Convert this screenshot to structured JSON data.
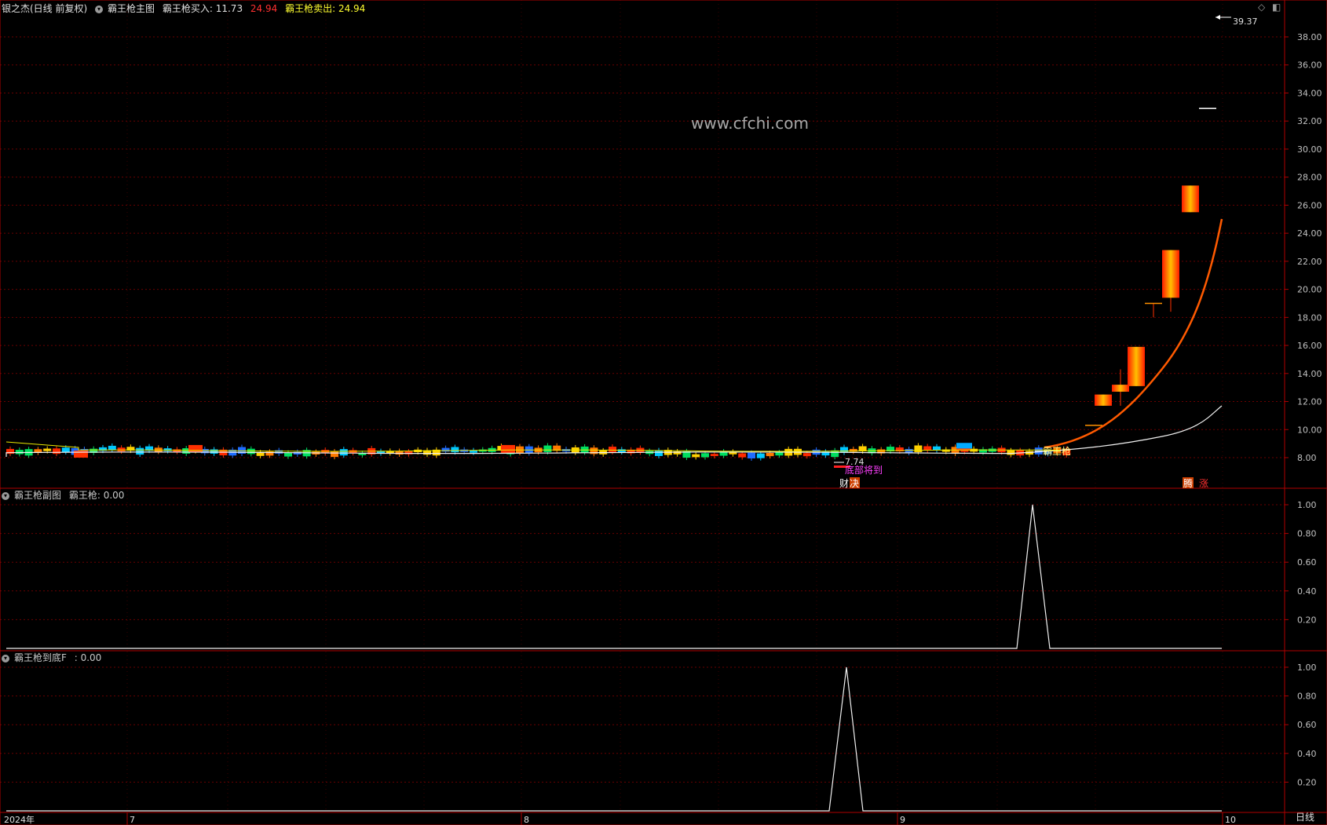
{
  "main_header": {
    "stock_label": "银之杰(日线 前复权)",
    "indicator_name": "霸王枪主图",
    "buy_label": "霸王枪买入: ",
    "buy_value": "11.73",
    "buy_value2": "24.94",
    "sell_label": "霸王枪卖出: ",
    "sell_value": "24.94"
  },
  "sub1_header": {
    "indicator_name": "霸王枪副图",
    "value_label": "霸王枪: 0.00"
  },
  "sub2_header": {
    "indicator_name": "霸王枪到底F",
    "value_label": ": 0.00"
  },
  "watermark": "www.cfchi.com",
  "max_price_label": "39.37",
  "low_price_label": "7.74",
  "period_label": "日线",
  "annotations": {
    "signal_name": "霸王枪",
    "bottom_arrive": "底部将到",
    "marker_cai": "财",
    "marker_jue": "决",
    "marker_teng": "腾",
    "marker_zhang": "涨"
  },
  "colors": {
    "background": "#000000",
    "axis_line": "#b00000",
    "grid": "#6a0000",
    "up_candle": "#ff2a00",
    "down_candle": "#00c8ff",
    "ma_line": "#ff5a00",
    "base_line": "#f0f0f0"
  },
  "chart_data": [
    {
      "type": "candlestick",
      "title": "霸王枪主图",
      "ylim": [
        7.0,
        39.37
      ],
      "y_ticks": [
        "8.00",
        "10.00",
        "12.00",
        "14.00",
        "16.00",
        "18.00",
        "20.00",
        "22.00",
        "24.00",
        "26.00",
        "28.00",
        "30.00",
        "32.00",
        "34.00",
        "36.00",
        "38.00"
      ],
      "x_ticks": [
        "2024年",
        "7",
        "8",
        "9",
        "10"
      ],
      "series": [
        {
          "name": "霸王枪买入",
          "values": [
            11.73
          ]
        },
        {
          "name": "霸王枪卖出",
          "values": [
            24.94
          ]
        }
      ],
      "highest": 39.37,
      "lowest": 7.74,
      "late_candles": [
        {
          "o": 10.3,
          "c": 10.3,
          "h": 10.3,
          "l": 10.3
        },
        {
          "o": 11.7,
          "c": 12.5,
          "h": 12.5,
          "l": 11.7
        },
        {
          "o": 12.7,
          "c": 13.2,
          "h": 14.3,
          "l": 11.7
        },
        {
          "o": 13.1,
          "c": 15.9,
          "h": 15.9,
          "l": 13.1
        },
        {
          "o": 19.0,
          "c": 19.0,
          "h": 19.0,
          "l": 18.0
        },
        {
          "o": 19.4,
          "c": 22.8,
          "h": 22.8,
          "l": 18.4
        },
        {
          "o": 25.5,
          "c": 27.4,
          "h": 27.4,
          "l": 25.5
        },
        {
          "o": 32.9,
          "c": 32.9,
          "h": 32.9,
          "l": 32.9
        }
      ]
    },
    {
      "type": "line",
      "title": "霸王枪副图",
      "ylim": [
        0,
        1.0
      ],
      "y_ticks": [
        "0.20",
        "0.40",
        "0.60",
        "0.80",
        "1.00"
      ],
      "series": [
        {
          "name": "霸王枪",
          "peak_value": 1.0,
          "last_value": 0.0
        }
      ]
    },
    {
      "type": "line",
      "title": "霸王枪到底F",
      "ylim": [
        0,
        1.0
      ],
      "y_ticks": [
        "0.20",
        "0.40",
        "0.60",
        "0.80",
        "1.00"
      ],
      "series": [
        {
          "name": "霸王枪到底F",
          "peak_value": 1.0,
          "last_value": 0.0
        }
      ]
    }
  ]
}
